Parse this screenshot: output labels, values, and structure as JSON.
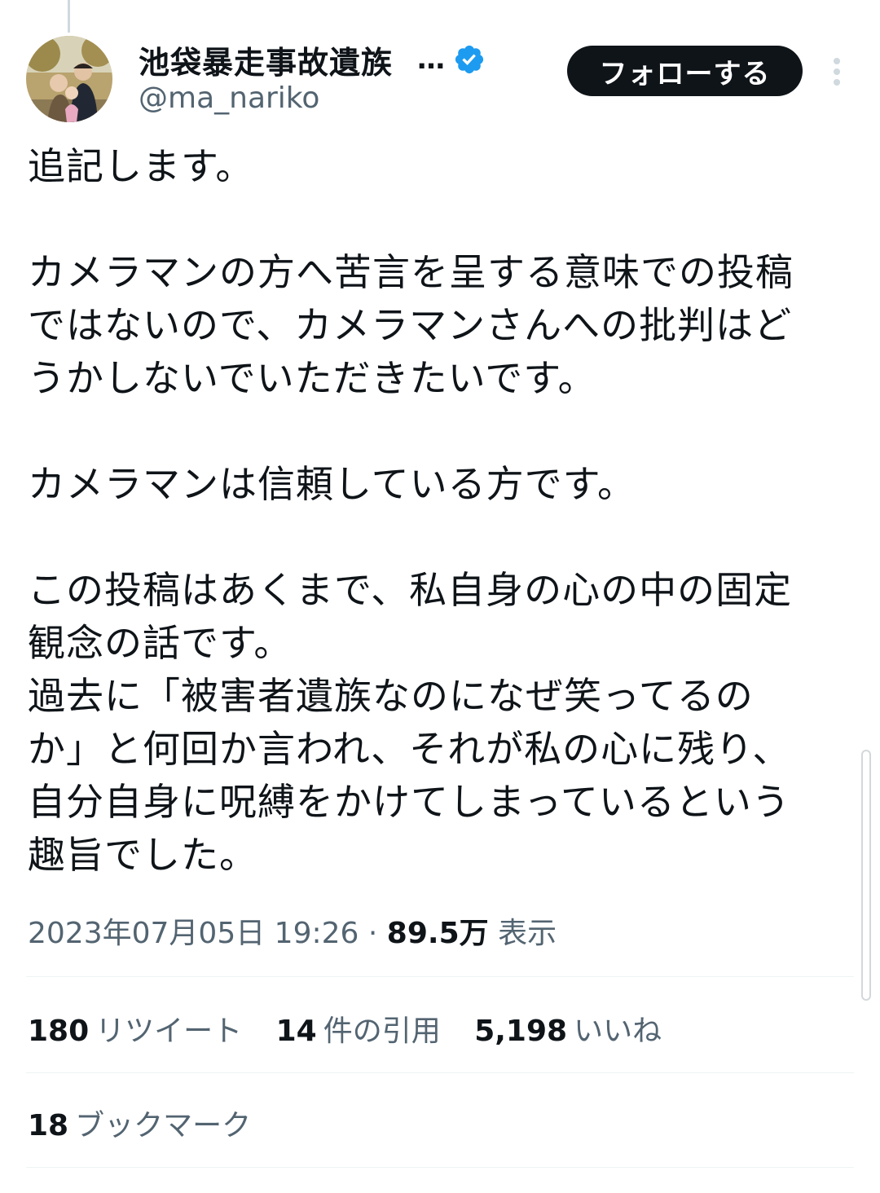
{
  "author": {
    "display_name": "池袋暴走事故遺族",
    "truncation": "…",
    "handle": "@ma_nariko",
    "verified": true,
    "avatar_icon": "family-photo-avatar"
  },
  "follow_button": {
    "label": "フォローする"
  },
  "more_menu": {
    "icon": "vertical-ellipsis-icon"
  },
  "tweet": {
    "lines": [
      "追記します。",
      "",
      "カメラマンの方へ苦言を呈する意味での投稿",
      "ではないので、カメラマンさんへの批判はど",
      "うかしないでいただきたいです。",
      "",
      "カメラマンは信頼している方です。",
      "",
      "この投稿はあくまで、私自身の心の中の固定",
      "観念の話です。",
      "過去に「被害者遺族なのになぜ笑ってるの",
      "か」と何回か言われ、それが私の心に残り、",
      "自分自身に呪縛をかけてしまっているという",
      "趣旨でした。"
    ]
  },
  "meta": {
    "timestamp": "2023年07月05日 19:26",
    "separator": "·",
    "views_count": "89.5万",
    "views_label": "表示"
  },
  "stats": {
    "retweets": {
      "count": "180",
      "label": "リツイート"
    },
    "quotes": {
      "count": "14",
      "label": "件の引用"
    },
    "likes": {
      "count": "5,198",
      "label": "いいね"
    },
    "bookmarks": {
      "count": "18",
      "label": "ブックマーク"
    }
  },
  "colors": {
    "text_primary": "#0f1419",
    "text_secondary": "#536471",
    "verified_blue": "#1d9bf0",
    "divider": "#eff3f4",
    "follow_button_bg": "#0f1419"
  }
}
